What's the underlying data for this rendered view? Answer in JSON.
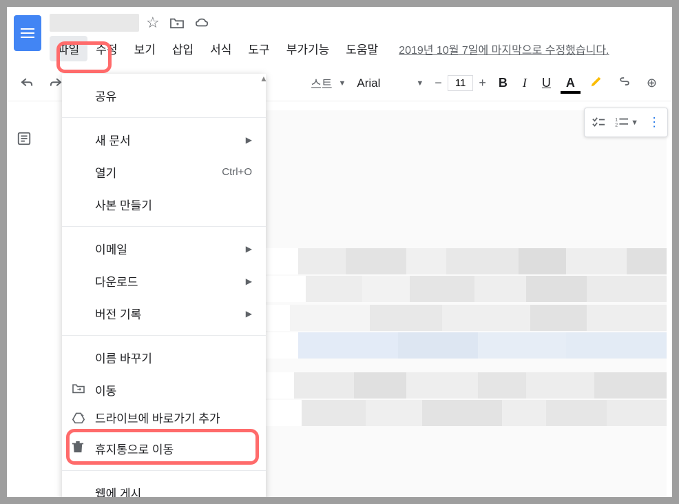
{
  "header": {
    "star_icon": "star",
    "move_icon": "folder-add",
    "cloud_icon": "cloud"
  },
  "menubar": {
    "file": "파일",
    "edit": "수정",
    "view": "보기",
    "insert": "삽입",
    "format": "서식",
    "tools": "도구",
    "addons": "부가기능",
    "help": "도움말",
    "last_edit": "2019년 10월 7일에 마지막으로 수정했습니다."
  },
  "toolbar": {
    "style_dropdown": "스트",
    "font_name": "Arial",
    "font_size": "11",
    "bold": "B",
    "italic": "I",
    "underline": "U",
    "text_color": "A"
  },
  "file_menu": {
    "share": "공유",
    "new_doc": "새 문서",
    "open": "열기",
    "open_shortcut": "Ctrl+O",
    "make_copy": "사본 만들기",
    "email": "이메일",
    "download": "다운로드",
    "version_history": "버전 기록",
    "rename": "이름 바꾸기",
    "move": "이동",
    "add_shortcut": "드라이브에 바로가기 추가",
    "move_to_trash": "휴지통으로 이동",
    "publish_web": "웹에 게시"
  }
}
